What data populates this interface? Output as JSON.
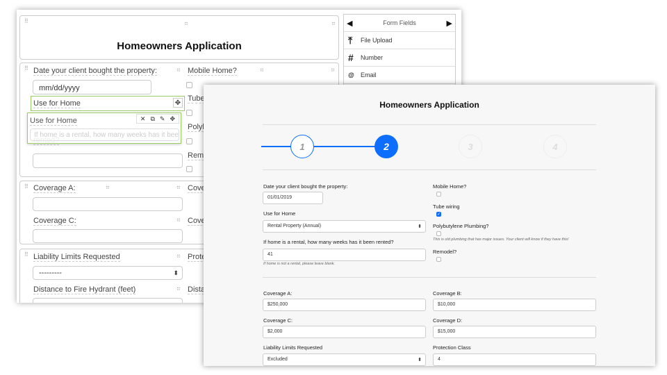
{
  "builder": {
    "title": "Homeowners Application",
    "date_label": "Date your client bought the property:",
    "date_placeholder": "mm/dd/yyyy",
    "use_label": "Use for Home",
    "drag_label": "Use for Home",
    "rental_label_ghost": "If home is a rental, how many weeks has it been",
    "rental_label_tail": "rented?",
    "mobile_label": "Mobile Home?",
    "tube_label": "Tube",
    "poly_label": "Polyb",
    "remodel_label": "Remo",
    "coverage_a": "Coverage A:",
    "coverage_b": "Cove",
    "coverage_c": "Coverage C:",
    "coverage_d": "Cove",
    "liability_label": "Liability Limits Requested",
    "liability_value": "---------",
    "protection_label": "Prote",
    "hydrant_label": "Distance to Fire Hydrant (feet)",
    "distance_label": "Distar"
  },
  "panel": {
    "title": "Form Fields",
    "items": [
      {
        "icon": "upload-icon",
        "label": "File Upload"
      },
      {
        "icon": "hash-icon",
        "label": "Number"
      },
      {
        "icon": "at-icon",
        "label": "Email"
      }
    ]
  },
  "form": {
    "title": "Homeowners Application",
    "steps": [
      "1",
      "2",
      "3",
      "4"
    ],
    "current_step": 2,
    "accent": "#0d6efd",
    "date_label": "Date your client bought the property:",
    "date_value": "01/01/2019",
    "use_label": "Use for Home",
    "use_value": "Rental Property (Annual)",
    "rental_label": "If home is a rental, how many weeks has it been rented?",
    "rental_value": "41",
    "rental_help": "If home is not a rental, please leave blank.",
    "mobile_label": "Mobile Home?",
    "tube_label": "Tube wiring",
    "tube_checked": true,
    "poly_label": "Polybutylene Plumbing?",
    "poly_help": "This is old plumbing that has major issues. Your client will know if they have this!",
    "remodel_label": "Remodel?",
    "cov_a_label": "Coverage A:",
    "cov_a_value": "$250,000",
    "cov_b_label": "Coverage B:",
    "cov_b_value": "$10,000",
    "cov_c_label": "Coverage C:",
    "cov_c_value": "$2,000",
    "cov_d_label": "Coverage D:",
    "cov_d_value": "$15,000",
    "liability_label": "Liability Limits Requested",
    "liability_value": "Excluded",
    "protection_label": "Protection Class",
    "protection_value": "4"
  }
}
